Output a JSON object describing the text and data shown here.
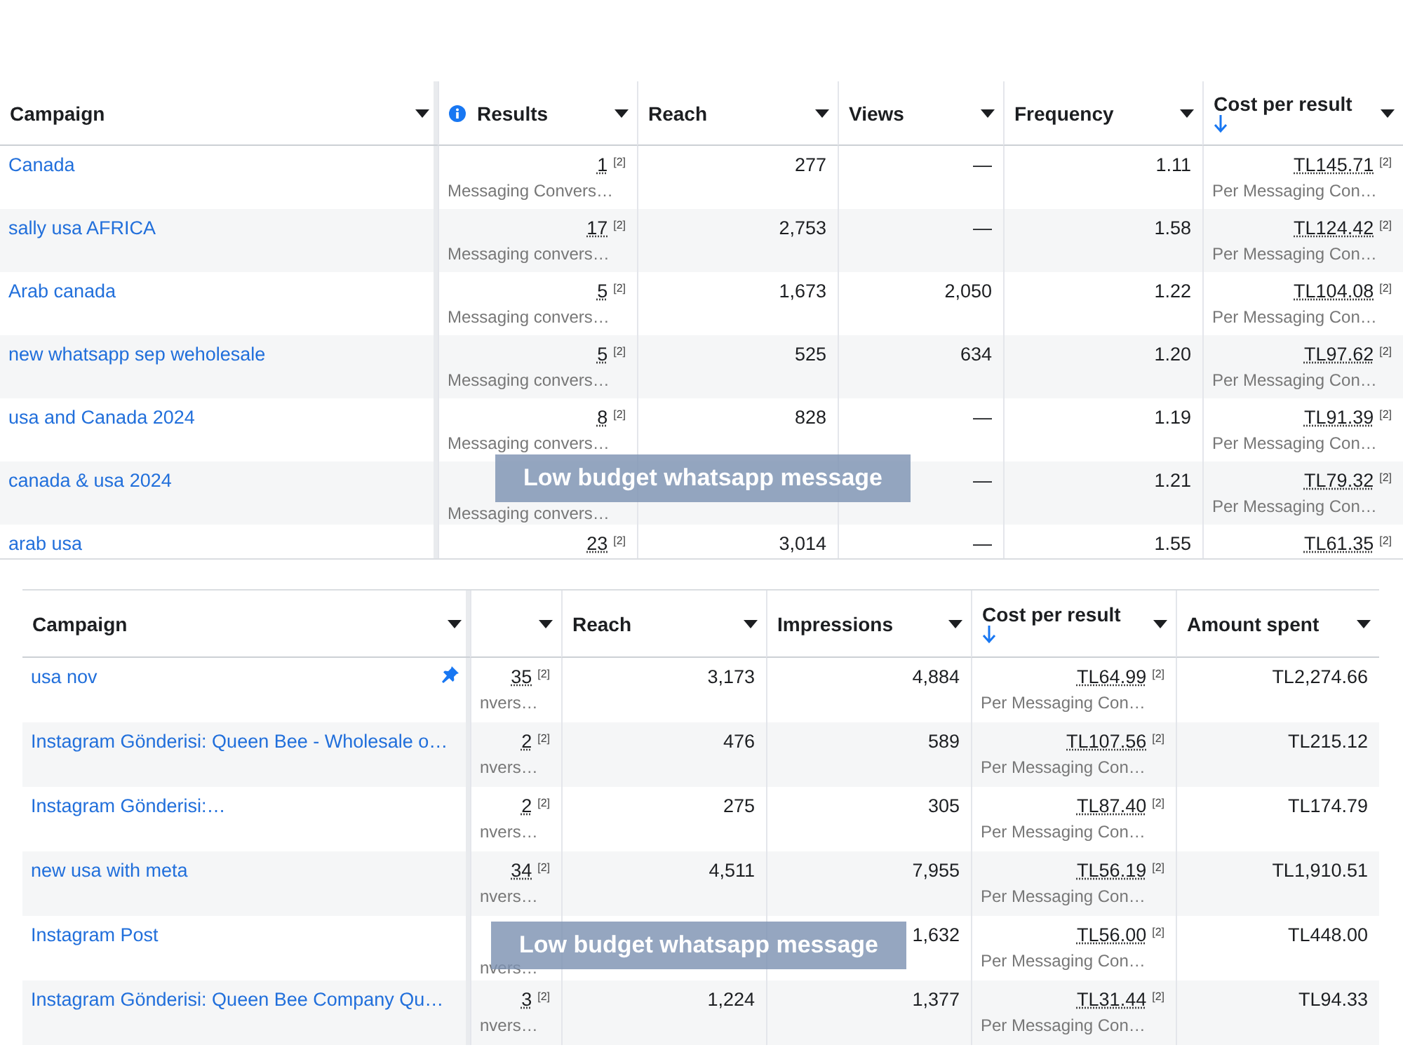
{
  "tables": [
    {
      "caption": "Low budget whatsapp message",
      "columns": [
        {
          "label": "Campaign",
          "info": false,
          "sorted": false
        },
        {
          "label": "Results",
          "info": true,
          "sorted": false
        },
        {
          "label": "Reach",
          "info": false,
          "sorted": false
        },
        {
          "label": "Views",
          "info": false,
          "sorted": false
        },
        {
          "label": "Frequency",
          "info": false,
          "sorted": false
        },
        {
          "label": "Cost per result",
          "info": false,
          "sorted": true
        }
      ],
      "rows": [
        {
          "pinned": false,
          "cells": [
            {
              "value": "Canada"
            },
            {
              "value": "1",
              "note": "[2]",
              "sub": "Messaging Convers…"
            },
            {
              "value": "277"
            },
            {
              "value": "—"
            },
            {
              "value": "1.11"
            },
            {
              "value": "TL145.71",
              "note": "[2]",
              "sub": "Per Messaging Con…"
            }
          ]
        },
        {
          "pinned": false,
          "cells": [
            {
              "value": "sally usa AFRICA"
            },
            {
              "value": "17",
              "note": "[2]",
              "sub": "Messaging convers…"
            },
            {
              "value": "2,753"
            },
            {
              "value": "—"
            },
            {
              "value": "1.58"
            },
            {
              "value": "TL124.42",
              "note": "[2]",
              "sub": "Per Messaging Con…"
            }
          ]
        },
        {
          "pinned": false,
          "cells": [
            {
              "value": "Arab canada"
            },
            {
              "value": "5",
              "note": "[2]",
              "sub": "Messaging convers…"
            },
            {
              "value": "1,673"
            },
            {
              "value": "2,050"
            },
            {
              "value": "1.22"
            },
            {
              "value": "TL104.08",
              "note": "[2]",
              "sub": "Per Messaging Con…"
            }
          ]
        },
        {
          "pinned": false,
          "cells": [
            {
              "value": "new whatsapp sep weholesale"
            },
            {
              "value": "5",
              "note": "[2]",
              "sub": "Messaging convers…"
            },
            {
              "value": "525"
            },
            {
              "value": "634"
            },
            {
              "value": "1.20"
            },
            {
              "value": "TL97.62",
              "note": "[2]",
              "sub": "Per Messaging Con…"
            }
          ]
        },
        {
          "pinned": false,
          "cells": [
            {
              "value": "usa and Canada 2024"
            },
            {
              "value": "8",
              "note": "[2]",
              "sub": "Messaging convers…"
            },
            {
              "value": "828"
            },
            {
              "value": "—"
            },
            {
              "value": "1.19"
            },
            {
              "value": "TL91.39",
              "note": "[2]",
              "sub": "Per Messaging Con…"
            }
          ]
        },
        {
          "pinned": false,
          "cells": [
            {
              "value": "canada & usa 2024"
            },
            {
              "sub": "Messaging convers…"
            },
            {},
            {
              "value": "—"
            },
            {
              "value": "1.21"
            },
            {
              "value": "TL79.32",
              "note": "[2]",
              "sub": "Per Messaging Con…"
            }
          ]
        },
        {
          "pinned": false,
          "cells": [
            {
              "value": "arab usa"
            },
            {
              "value": "23",
              "note": "[2]"
            },
            {
              "value": "3,014"
            },
            {
              "value": "—"
            },
            {
              "value": "1.55"
            },
            {
              "value": "TL61.35",
              "note": "[2]"
            }
          ]
        }
      ]
    },
    {
      "caption": "Low budget whatsapp message",
      "columns": [
        {
          "label": "Campaign",
          "sorted": false
        },
        {
          "sorted": false
        },
        {
          "label": "Reach",
          "sorted": false
        },
        {
          "label": "Impressions",
          "sorted": false
        },
        {
          "label": "Cost per result",
          "sorted": true
        },
        {
          "label": "Amount spent",
          "sorted": false
        }
      ],
      "rows": [
        {
          "pinned": true,
          "cells": [
            {
              "value": "usa nov"
            },
            {
              "value": "35",
              "note": "[2]",
              "sub": "nvers…"
            },
            {
              "value": "3,173"
            },
            {
              "value": "4,884"
            },
            {
              "value": "TL64.99",
              "note": "[2]",
              "sub": "Per Messaging Con…"
            },
            {
              "value": "TL2,274.66"
            }
          ]
        },
        {
          "pinned": false,
          "cells": [
            {
              "value": "Instagram Gönderisi: Queen Bee - Wholesale o…"
            },
            {
              "value": "2",
              "note": "[2]",
              "sub": "nvers…"
            },
            {
              "value": "476"
            },
            {
              "value": "589"
            },
            {
              "value": "TL107.56",
              "note": "[2]",
              "sub": "Per Messaging Con…"
            },
            {
              "value": "TL215.12"
            }
          ]
        },
        {
          "pinned": false,
          "cells": [
            {
              "value": "Instagram Gönderisi:…"
            },
            {
              "value": "2",
              "note": "[2]",
              "sub": "nvers…"
            },
            {
              "value": "275"
            },
            {
              "value": "305"
            },
            {
              "value": "TL87.40",
              "note": "[2]",
              "sub": "Per Messaging Con…"
            },
            {
              "value": "TL174.79"
            }
          ]
        },
        {
          "pinned": false,
          "cells": [
            {
              "value": "new usa with meta"
            },
            {
              "value": "34",
              "note": "[2]",
              "sub": "nvers…"
            },
            {
              "value": "4,511"
            },
            {
              "value": "7,955"
            },
            {
              "value": "TL56.19",
              "note": "[2]",
              "sub": "Per Messaging Con…"
            },
            {
              "value": "TL1,910.51"
            }
          ]
        },
        {
          "pinned": false,
          "cells": [
            {
              "value": "Instagram Post"
            },
            {
              "sub": "nvers…"
            },
            {},
            {
              "value": "1,632"
            },
            {
              "value": "TL56.00",
              "note": "[2]",
              "sub": "Per Messaging Con…"
            },
            {
              "value": "TL448.00"
            }
          ]
        },
        {
          "pinned": false,
          "cells": [
            {
              "value": "Instagram Gönderisi: Queen Bee Company Qu…"
            },
            {
              "value": "3",
              "note": "[2]",
              "sub": "nvers…"
            },
            {
              "value": "1,224"
            },
            {
              "value": "1,377"
            },
            {
              "value": "TL31.44",
              "note": "[2]",
              "sub": "Per Messaging Con…"
            },
            {
              "value": "TL94.33"
            }
          ]
        }
      ]
    }
  ]
}
